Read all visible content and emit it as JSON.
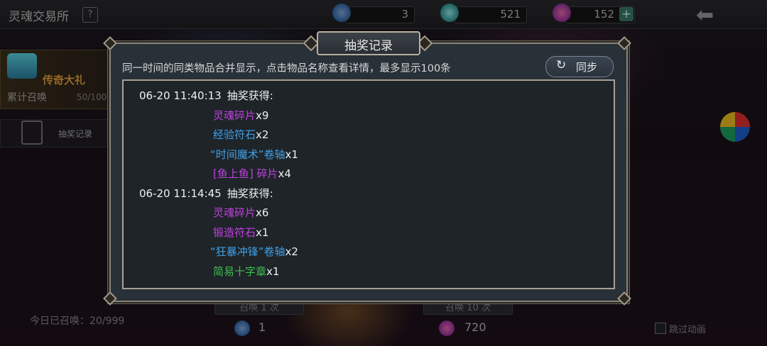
{
  "header": {
    "title": "灵魂交易所",
    "help_icon": "?",
    "resources": [
      {
        "icon": "compass-coin-icon",
        "value": "3"
      },
      {
        "icon": "cyan-gem-icon",
        "value": "521"
      },
      {
        "icon": "purple-crystal-icon",
        "value": "152"
      }
    ],
    "plus_label": "+",
    "back_icon": "back-arrow-icon"
  },
  "side": {
    "legend_text": "传奇大礼",
    "cumulative_label": "累计召唤",
    "cumulative_progress": "50/100",
    "record_label": "抽奖记录"
  },
  "modal": {
    "title": "抽奖记录",
    "notice": "同一时间的同类物品合并显示，点击物品名称查看详情，最多显示100条",
    "sync_label": "同步",
    "entries": [
      {
        "time": "06-20 11:40:13",
        "label": "抽奖获得:",
        "items": [
          {
            "name": "灵魂碎片",
            "qty": "x9",
            "color": "#c040e0"
          },
          {
            "name": "经验符石",
            "qty": "x2",
            "color": "#40a0e8"
          },
          {
            "name": "“时间魔术”卷轴",
            "qty": "x1",
            "color": "#40a0e8"
          },
          {
            "name": "[鱼上鱼] 碎片",
            "qty": "x4",
            "color": "#c040e0"
          }
        ]
      },
      {
        "time": "06-20 11:14:45",
        "label": "抽奖获得:",
        "items": [
          {
            "name": "灵魂碎片",
            "qty": "x6",
            "color": "#c040e0"
          },
          {
            "name": "锻造符石",
            "qty": "x1",
            "color": "#c040e0"
          },
          {
            "name": "“狂暴冲锋”卷轴",
            "qty": "x2",
            "color": "#40a0e8"
          },
          {
            "name": "简易十字章",
            "qty": "x1",
            "color": "#40c050"
          }
        ]
      }
    ]
  },
  "bottom": {
    "today_summoned": "今日已召唤：20/999",
    "summon_one_label": "召唤 1 次",
    "summon_ten_label": "召唤 10 次",
    "cost_one": "1",
    "cost_ten": "720",
    "skip_label": "跳过动画"
  }
}
